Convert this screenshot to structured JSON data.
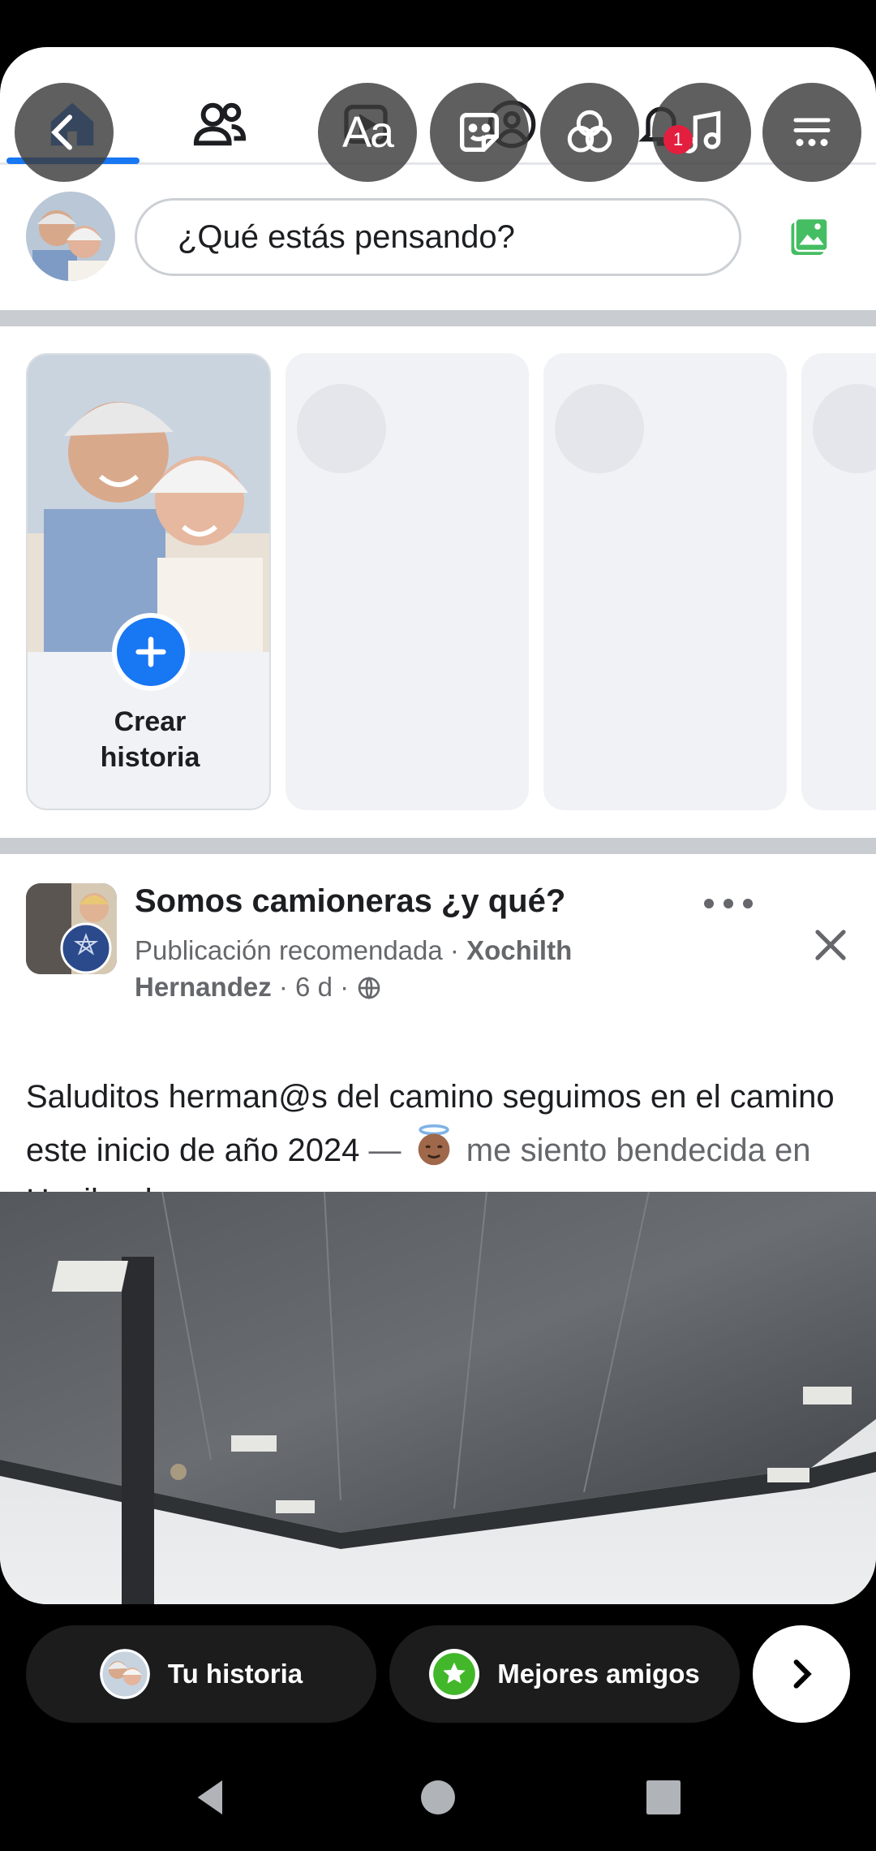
{
  "composer": {
    "placeholder": "¿Qué estás pensando?"
  },
  "notifications": {
    "badge_count": "1"
  },
  "stories": {
    "create_label_line1": "Crear",
    "create_label_line2": "historia"
  },
  "post": {
    "group_name": "Somos camioneras ¿y qué?",
    "meta_prefix": "Publicación recomendada · ",
    "author": "Xochilth Hernandez",
    "time": " · 6 d · ",
    "text_main": "Saluditos herman@s del camino seguimos en el camino este inicio de año 2024",
    "text_dash": " — ",
    "text_feeling": " me siento bendecida en ",
    "text_place": "Haviland",
    "text_end": "."
  },
  "bottom": {
    "story_chip": "Tu historia",
    "friends_chip": "Mejores amigos"
  },
  "colors": {
    "accent": "#1877f2",
    "badge": "#e41e3f",
    "green": "#42b72a"
  },
  "icons": [
    "home-icon",
    "friends-icon",
    "text-tool-icon",
    "sticker-icon",
    "effects-icon",
    "notifications-icon",
    "music-icon",
    "more-icon",
    "photo-icon",
    "more-dots-icon",
    "close-icon",
    "globe-icon",
    "chevron-right-icon",
    "star-icon"
  ]
}
